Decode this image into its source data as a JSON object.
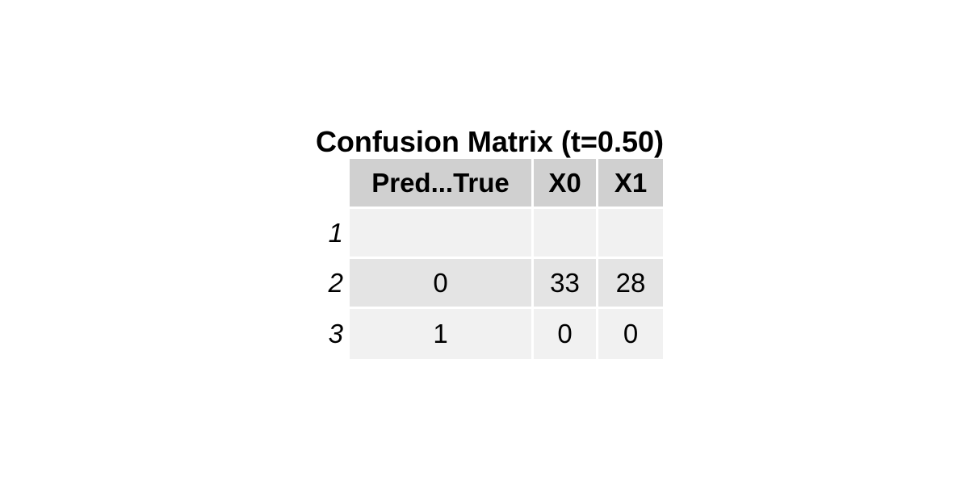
{
  "chart_data": {
    "type": "table",
    "title": "Confusion Matrix (t=0.50)",
    "columns": [
      "Pred...True",
      "X0",
      "X1"
    ],
    "row_names": [
      "1",
      "2",
      "3"
    ],
    "rows": [
      [
        "",
        "",
        ""
      ],
      [
        "0",
        "33",
        "28"
      ],
      [
        "1",
        "0",
        "0"
      ]
    ],
    "colors": {
      "header_fill": "#d0d0d0",
      "row_fill_even": "#f1f1f1",
      "row_fill_odd": "#e4e4e4",
      "border": "#ffffff"
    }
  }
}
